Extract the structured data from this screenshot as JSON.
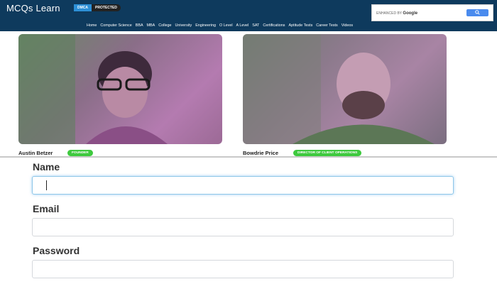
{
  "header": {
    "logo": "MCQs Learn",
    "badge_dmca": "DMCA",
    "badge_protected": "PROTECTED",
    "search": {
      "enhanced_by": "ENHANCED BY",
      "brand": "Google",
      "button_icon": "search-icon"
    },
    "nav": [
      "Home",
      "Computer Science",
      "BBA",
      "MBA",
      "College",
      "University",
      "Engineering",
      "O Level",
      "A Level",
      "SAT",
      "Certifications",
      "Aptitude Tests",
      "Career Tests",
      "Videos"
    ]
  },
  "team": [
    {
      "name": "Austin Betzer",
      "role": "FOUNDER"
    },
    {
      "name": "Bowdrie Price",
      "role": "DIRECTOR OF CLIENT OPERATIONS"
    }
  ],
  "form": {
    "name_label": "Name",
    "name_value": "",
    "email_label": "Email",
    "email_value": "",
    "password_label": "Password",
    "password_value": ""
  },
  "colors": {
    "header_bg": "#0e3a5d",
    "badge_green": "#3ec93e",
    "focus_border": "#8ec7e8"
  }
}
